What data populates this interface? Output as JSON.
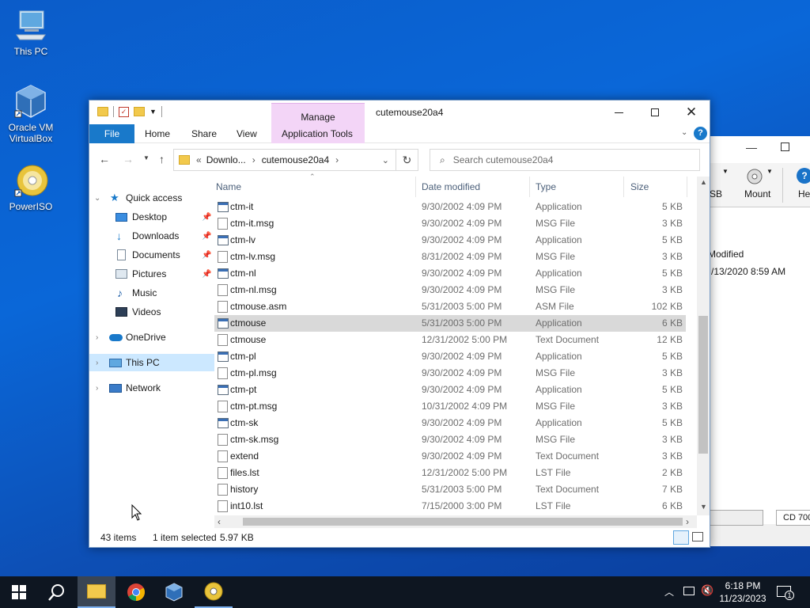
{
  "desktop": {
    "icons": [
      {
        "label": "This PC"
      },
      {
        "label": "Oracle VM VirtualBox"
      },
      {
        "label": "PowerISO"
      }
    ]
  },
  "background_window": {
    "toolbar": {
      "item1": "SB",
      "item2": "Mount",
      "item3": "He"
    },
    "col_header": "Modified",
    "cell": "/13/2020 8:59 AM",
    "status": "CD 700"
  },
  "explorer": {
    "title": "cutemouse20a4",
    "manage_tab": "Manage",
    "ribbon_tabs": {
      "file": "File",
      "home": "Home",
      "share": "Share",
      "view": "View",
      "app_tools": "Application Tools"
    },
    "address": {
      "prefix": "«",
      "crumbs": [
        "Downlo...",
        "cutemouse20a4"
      ]
    },
    "search": {
      "placeholder": "Search cutemouse20a4"
    },
    "nav": {
      "quick_access": "Quick access",
      "desktop": "Desktop",
      "downloads": "Downloads",
      "documents": "Documents",
      "pictures": "Pictures",
      "music": "Music",
      "videos": "Videos",
      "onedrive": "OneDrive",
      "this_pc": "This PC",
      "network": "Network"
    },
    "columns": {
      "name": "Name",
      "date": "Date modified",
      "type": "Type",
      "size": "Size"
    },
    "files": [
      {
        "name": "ctm-it",
        "date": "9/30/2002 4:09 PM",
        "type": "Application",
        "size": "5 KB",
        "kind": "app"
      },
      {
        "name": "ctm-it.msg",
        "date": "9/30/2002 4:09 PM",
        "type": "MSG File",
        "size": "3 KB",
        "kind": "doc"
      },
      {
        "name": "ctm-lv",
        "date": "9/30/2002 4:09 PM",
        "type": "Application",
        "size": "5 KB",
        "kind": "app"
      },
      {
        "name": "ctm-lv.msg",
        "date": "8/31/2002 4:09 PM",
        "type": "MSG File",
        "size": "3 KB",
        "kind": "doc"
      },
      {
        "name": "ctm-nl",
        "date": "9/30/2002 4:09 PM",
        "type": "Application",
        "size": "5 KB",
        "kind": "app"
      },
      {
        "name": "ctm-nl.msg",
        "date": "9/30/2002 4:09 PM",
        "type": "MSG File",
        "size": "3 KB",
        "kind": "doc"
      },
      {
        "name": "ctmouse.asm",
        "date": "5/31/2003 5:00 PM",
        "type": "ASM File",
        "size": "102 KB",
        "kind": "doc"
      },
      {
        "name": "ctmouse",
        "date": "5/31/2003 5:00 PM",
        "type": "Application",
        "size": "6 KB",
        "kind": "app",
        "selected": true
      },
      {
        "name": "ctmouse",
        "date": "12/31/2002 5:00 PM",
        "type": "Text Document",
        "size": "12 KB",
        "kind": "doc"
      },
      {
        "name": "ctm-pl",
        "date": "9/30/2002 4:09 PM",
        "type": "Application",
        "size": "5 KB",
        "kind": "app"
      },
      {
        "name": "ctm-pl.msg",
        "date": "9/30/2002 4:09 PM",
        "type": "MSG File",
        "size": "3 KB",
        "kind": "doc"
      },
      {
        "name": "ctm-pt",
        "date": "9/30/2002 4:09 PM",
        "type": "Application",
        "size": "5 KB",
        "kind": "app"
      },
      {
        "name": "ctm-pt.msg",
        "date": "10/31/2002 4:09 PM",
        "type": "MSG File",
        "size": "3 KB",
        "kind": "doc"
      },
      {
        "name": "ctm-sk",
        "date": "9/30/2002 4:09 PM",
        "type": "Application",
        "size": "5 KB",
        "kind": "app"
      },
      {
        "name": "ctm-sk.msg",
        "date": "9/30/2002 4:09 PM",
        "type": "MSG File",
        "size": "3 KB",
        "kind": "doc"
      },
      {
        "name": "extend",
        "date": "9/30/2002 4:09 PM",
        "type": "Text Document",
        "size": "3 KB",
        "kind": "doc"
      },
      {
        "name": "files.lst",
        "date": "12/31/2002 5:00 PM",
        "type": "LST File",
        "size": "2 KB",
        "kind": "doc"
      },
      {
        "name": "history",
        "date": "5/31/2003 5:00 PM",
        "type": "Text Document",
        "size": "7 KB",
        "kind": "doc"
      },
      {
        "name": "int10.lst",
        "date": "7/15/2000 3:00 PM",
        "type": "LST File",
        "size": "6 KB",
        "kind": "doc"
      }
    ],
    "status": {
      "count": "43 items",
      "selection": "1 item selected",
      "size": "5.97 KB"
    }
  },
  "taskbar": {
    "clock_time": "6:18 PM",
    "clock_date": "11/23/2023",
    "notifications": "1"
  },
  "colors": {
    "accent": "#1979ca",
    "manage": "#f3d5f7",
    "selection_nav": "#cce8ff",
    "selection_row": "#d9d9d9"
  }
}
